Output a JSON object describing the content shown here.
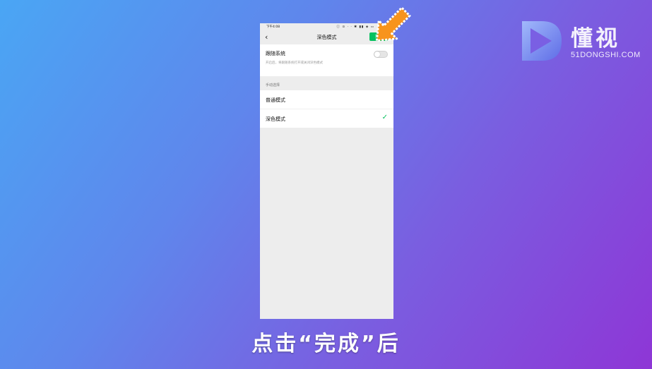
{
  "status_bar": {
    "time": "下午4:08",
    "icons": "ⓘ ⊙ · ·      ✱ ▮▮ ◈ ▭"
  },
  "nav": {
    "back_icon": "chevron-left",
    "title": "深色模式",
    "done_label": "完成"
  },
  "follow_system": {
    "title": "跟随系统",
    "description": "开启后，将跟随系统打开或关闭深色模式",
    "enabled": false
  },
  "manual": {
    "header": "手动选择",
    "options": [
      {
        "label": "普通模式",
        "selected": false
      },
      {
        "label": "深色模式",
        "selected": true
      }
    ]
  },
  "watermark": {
    "name_cn": "懂视",
    "name_en": "51DONGSHI.COM"
  },
  "caption": "点击“完成”后",
  "colors": {
    "accent_green": "#07c160",
    "arrow_orange": "#f7941d"
  }
}
